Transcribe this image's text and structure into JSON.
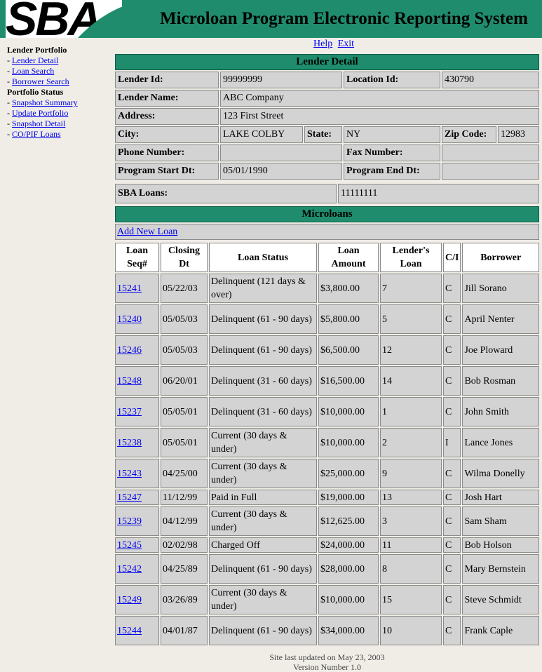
{
  "header": {
    "logo": "SBA",
    "title": "Microloan Program Electronic Reporting System"
  },
  "toplinks": {
    "help": "Help",
    "exit": "Exit"
  },
  "sidebar": {
    "section1": "Lender Portfolio",
    "items1": [
      "Lender Detail",
      "Loan Search",
      "Borrower Search"
    ],
    "section2": "Portfolio Status",
    "items2": [
      "Snapshot Summary",
      "Update Portfolio",
      "Snapshot Detail",
      "CO/PIF Loans"
    ]
  },
  "lender": {
    "bar_title": "Lender Detail",
    "lender_id_label": "Lender Id:",
    "lender_id": "99999999",
    "location_id_label": "Location Id:",
    "location_id": "430790",
    "name_label": "Lender Name:",
    "name": "ABC Company",
    "address_label": "Address:",
    "address": "123 First Street",
    "city_label": "City:",
    "city": "LAKE COLBY",
    "state_label": "State:",
    "state": "NY",
    "zip_label": "Zip Code:",
    "zip": "12983",
    "phone_label": "Phone Number:",
    "phone": "",
    "fax_label": "Fax Number:",
    "fax": "",
    "start_label": "Program Start Dt:",
    "start": "05/01/1990",
    "end_label": "Program End Dt:",
    "end": "",
    "sba_label": "SBA Loans:",
    "sba": "11111111"
  },
  "microloans": {
    "bar_title": "Microloans",
    "add_link": "Add New Loan",
    "columns": [
      "Loan Seq#",
      "Closing Dt",
      "Loan Status",
      "Loan Amount",
      "Lender's Loan",
      "C/I",
      "Borrower"
    ],
    "rows": [
      {
        "seq": "15241",
        "date": "05/22/03",
        "status": "Delinquent (121 days & over)",
        "amount": "$3,800.00",
        "lender": "7",
        "ci": "C",
        "borrower": "Jill Sorano",
        "tall": true
      },
      {
        "seq": "15240",
        "date": "05/05/03",
        "status": "Delinquent (61 - 90 days)",
        "amount": "$5,800.00",
        "lender": "5",
        "ci": "C",
        "borrower": "April Nenter",
        "tall": true
      },
      {
        "seq": "15246",
        "date": "05/05/03",
        "status": "Delinquent (61 - 90 days)",
        "amount": "$6,500.00",
        "lender": "12",
        "ci": "C",
        "borrower": "Joe Ploward",
        "tall": true
      },
      {
        "seq": "15248",
        "date": "06/20/01",
        "status": "Delinquent (31 - 60 days)",
        "amount": "$16,500.00",
        "lender": "14",
        "ci": "C",
        "borrower": "Bob Rosman",
        "tall": true
      },
      {
        "seq": "15237",
        "date": "05/05/01",
        "status": "Delinquent (31 - 60 days)",
        "amount": "$10,000.00",
        "lender": "1",
        "ci": "C",
        "borrower": "John Smith",
        "tall": true
      },
      {
        "seq": "15238",
        "date": "05/05/01",
        "status": "Current (30 days & under)",
        "amount": "$10,000.00",
        "lender": "2",
        "ci": "I",
        "borrower": "Lance Jones",
        "tall": true
      },
      {
        "seq": "15243",
        "date": "04/25/00",
        "status": "Current (30 days & under)",
        "amount": "$25,000.00",
        "lender": "9",
        "ci": "C",
        "borrower": "Wilma Donelly",
        "tall": true
      },
      {
        "seq": "15247",
        "date": "11/12/99",
        "status": "Paid in Full",
        "amount": "$19,000.00",
        "lender": "13",
        "ci": "C",
        "borrower": "Josh Hart",
        "tall": false
      },
      {
        "seq": "15239",
        "date": "04/12/99",
        "status": "Current (30 days & under)",
        "amount": "$12,625.00",
        "lender": "3",
        "ci": "C",
        "borrower": "Sam Sham",
        "tall": true
      },
      {
        "seq": "15245",
        "date": "02/02/98",
        "status": "Charged Off",
        "amount": "$24,000.00",
        "lender": "11",
        "ci": "C",
        "borrower": "Bob Holson",
        "tall": false
      },
      {
        "seq": "15242",
        "date": "04/25/89",
        "status": "Delinquent (61 - 90 days)",
        "amount": "$28,000.00",
        "lender": "8",
        "ci": "C",
        "borrower": "Mary Bernstein",
        "tall": true
      },
      {
        "seq": "15249",
        "date": "03/26/89",
        "status": "Current (30 days & under)",
        "amount": "$10,000.00",
        "lender": "15",
        "ci": "C",
        "borrower": "Steve Schmidt",
        "tall": true
      },
      {
        "seq": "15244",
        "date": "04/01/87",
        "status": "Delinquent (61 - 90 days)",
        "amount": "$34,000.00",
        "lender": "10",
        "ci": "C",
        "borrower": "Frank Caple",
        "tall": true
      }
    ]
  },
  "footer": {
    "updated": "Site last updated on May 23, 2003",
    "version": "Version Number 1.0"
  },
  "colors": {
    "header_green": "#1f8d6d",
    "cell_gray": "#d3d3d3",
    "link": "#0000ee"
  }
}
